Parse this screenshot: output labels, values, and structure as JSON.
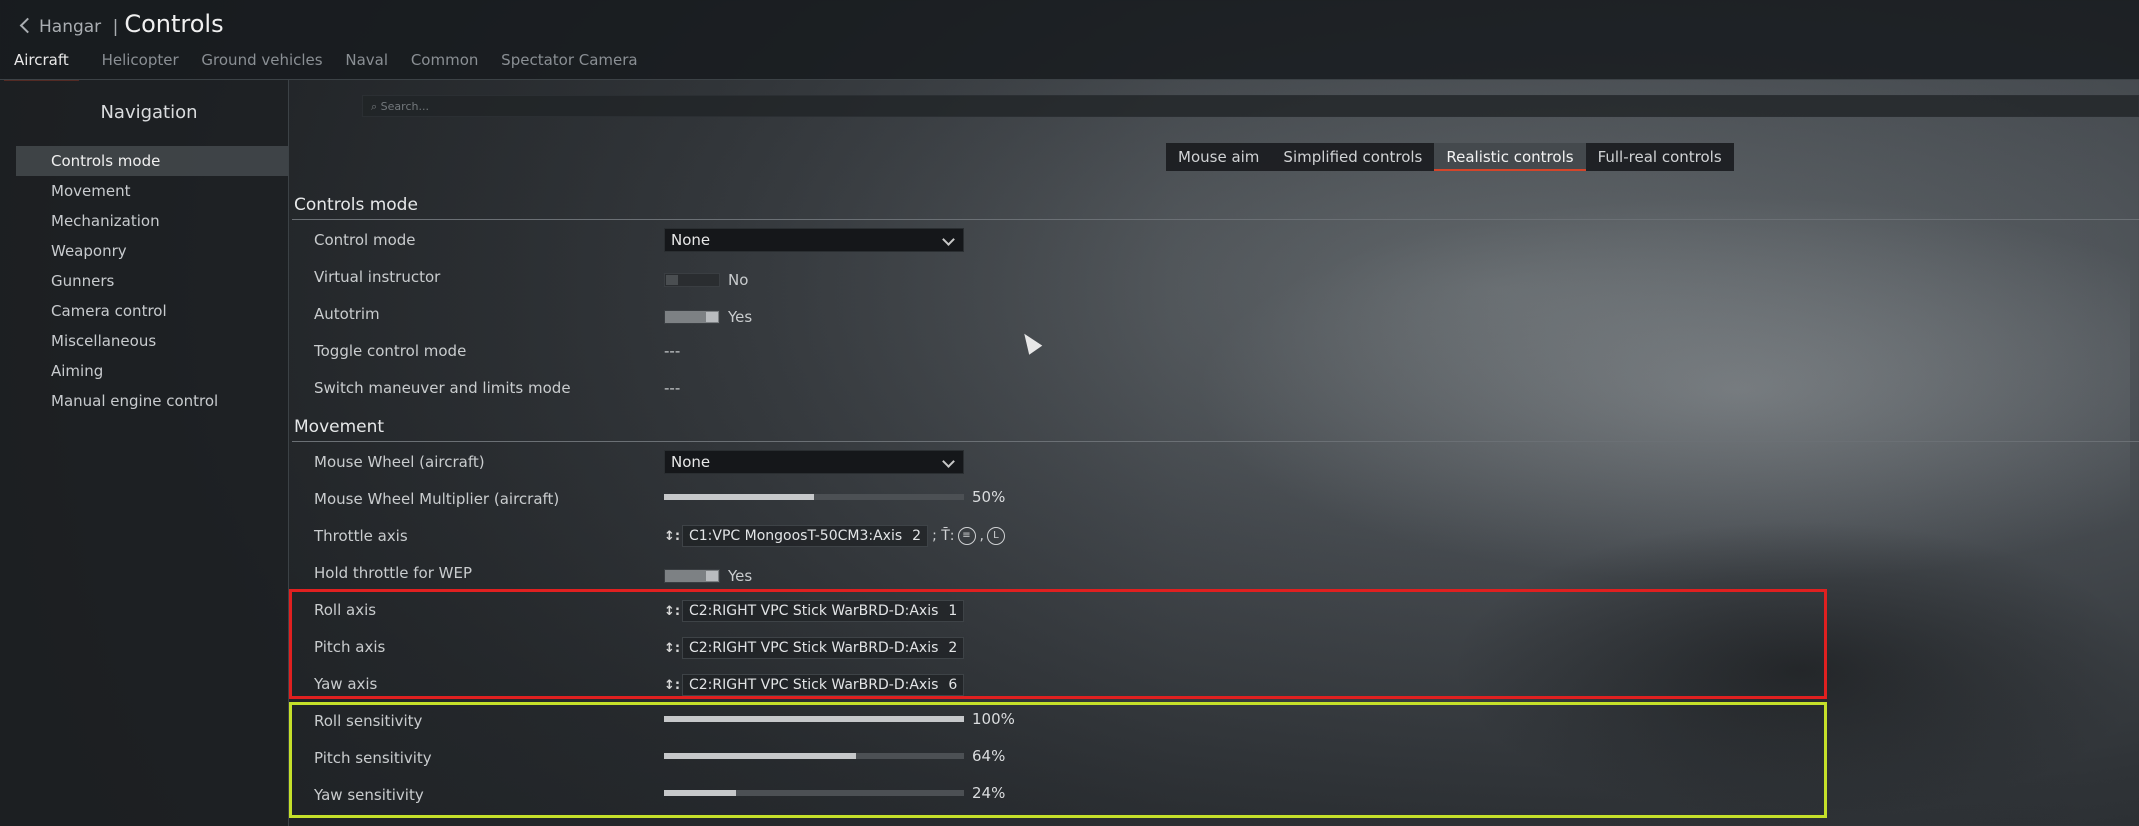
{
  "header": {
    "back_label": "Hangar",
    "separator": "|",
    "title": "Controls"
  },
  "tabs": [
    "Aircraft",
    "Helicopter",
    "Ground vehicles",
    "Naval",
    "Common",
    "Spectator Camera"
  ],
  "nav": {
    "title": "Navigation",
    "items": [
      "Controls mode",
      "Movement",
      "Mechanization",
      "Weaponry",
      "Gunners",
      "Camera control",
      "Miscellaneous",
      "Aiming",
      "Manual engine control"
    ]
  },
  "search": {
    "placeholder": "Search..."
  },
  "modes": [
    "Mouse aim",
    "Simplified controls",
    "Realistic controls",
    "Full-real controls"
  ],
  "controls_mode": {
    "title": "Controls mode",
    "control_mode": {
      "label": "Control mode",
      "value": "None"
    },
    "virtual_instructor": {
      "label": "Virtual instructor",
      "value": "No",
      "on": false
    },
    "autotrim": {
      "label": "Autotrim",
      "value": "Yes",
      "on": true
    },
    "toggle_control_mode": {
      "label": "Toggle control mode",
      "value": "---"
    },
    "switch_maneuver": {
      "label": "Switch maneuver and limits mode",
      "value": "---"
    }
  },
  "movement": {
    "title": "Movement",
    "mouse_wheel": {
      "label": "Mouse Wheel (aircraft)",
      "value": "None"
    },
    "mouse_wheel_multiplier": {
      "label": "Mouse Wheel Multiplier (aircraft)",
      "value": "50%",
      "fraction": 0.5
    },
    "throttle_axis": {
      "label": "Throttle axis",
      "binding": "C1:VPC MongoosT-50CM3:Axis",
      "axis_num": "2",
      "arrow": "↕:",
      "extra": "; T̄:",
      "comma": ",",
      "circle1": "≡",
      "circle2": "L"
    },
    "hold_throttle": {
      "label": "Hold throttle for WEP",
      "value": "Yes",
      "on": true
    },
    "roll_axis": {
      "label": "Roll axis",
      "binding": "C2:RIGHT VPC Stick WarBRD-D:Axis",
      "axis_num": "1",
      "arrow": "↕:"
    },
    "pitch_axis": {
      "label": "Pitch axis",
      "binding": "C2:RIGHT VPC Stick WarBRD-D:Axis",
      "axis_num": "2",
      "arrow": "↕:"
    },
    "yaw_axis": {
      "label": "Yaw axis",
      "binding": "C2:RIGHT VPC Stick WarBRD-D:Axis",
      "axis_num": "6",
      "arrow": "↕:"
    },
    "roll_sensitivity": {
      "label": "Roll sensitivity",
      "value": "100%",
      "fraction": 1.0
    },
    "pitch_sensitivity": {
      "label": "Pitch sensitivity",
      "value": "64%",
      "fraction": 0.64
    },
    "yaw_sensitivity": {
      "label": "Yaw sensitivity",
      "value": "24%",
      "fraction": 0.24
    }
  },
  "colors": {
    "accent": "#d4452a",
    "highlight_red": "#e02020",
    "highlight_green": "#c5e02a"
  },
  "icons": {
    "back": "chevron-left-icon",
    "search": "search-icon",
    "dropdown": "chevron-down-icon",
    "cursor": "mouse-cursor-icon"
  }
}
